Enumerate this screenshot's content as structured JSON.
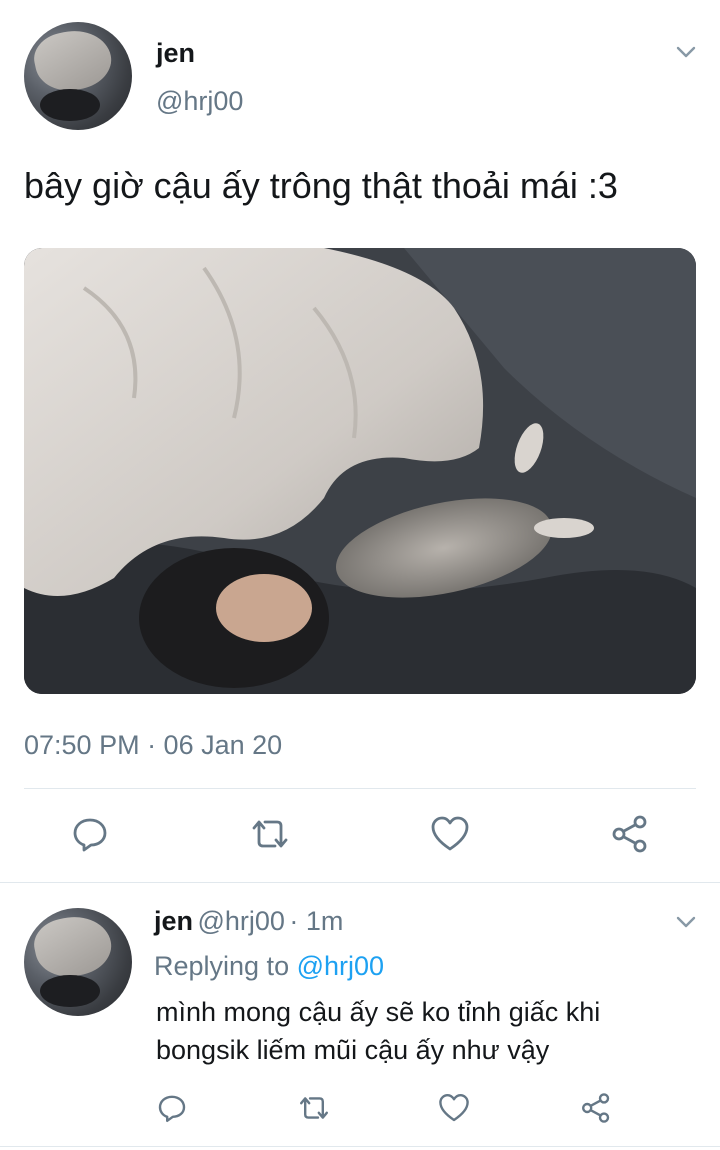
{
  "tweet": {
    "author_name": "jen",
    "author_handle": "@hrj00",
    "text": "bây giờ cậu ấy trông thật thoải mái :3",
    "timestamp": "07:50 PM · 06 Jan 20",
    "media_icon": "photo"
  },
  "reply": {
    "author_name": "jen",
    "author_handle": "@hrj00",
    "time": "· 1m",
    "replying_prefix": "Replying to",
    "replying_handle": "@hrj00",
    "text_line1": "mình mong cậu ấy sẽ ko tỉnh giấc khi",
    "text_line2": "bongsik liếm mũi cậu ấy như vậy"
  },
  "icons": {
    "menu": "chevron-down-icon",
    "reply": "reply-icon",
    "retweet": "retweet-icon",
    "like": "heart-icon",
    "share": "share-icon"
  },
  "colors": {
    "primary_text": "#14171a",
    "secondary_text": "#657786",
    "link": "#1da1f2",
    "divider": "#e1e8ed"
  }
}
